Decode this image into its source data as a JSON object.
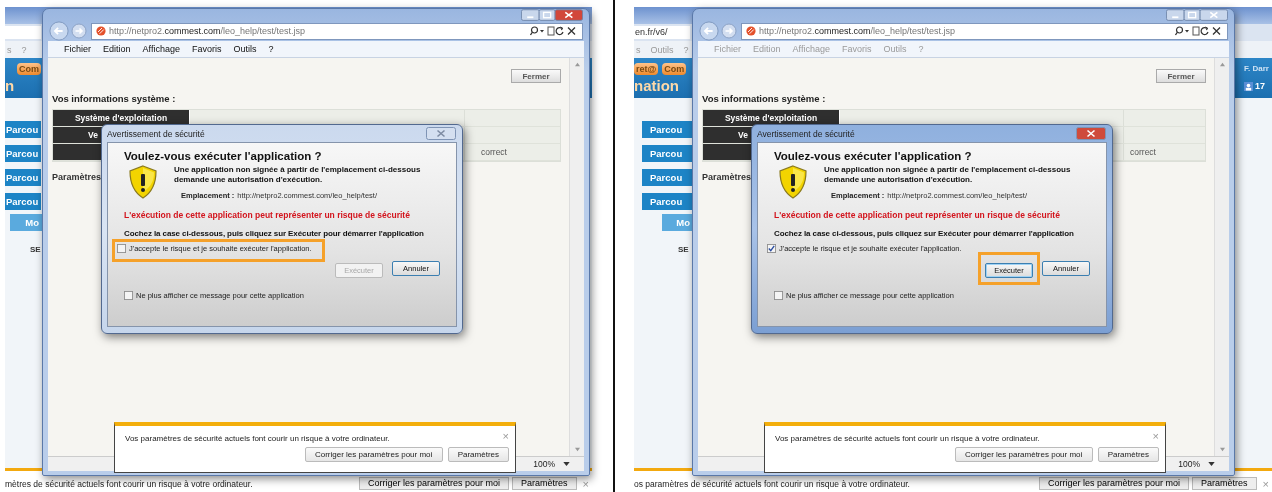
{
  "panels": [
    {
      "background": {
        "menu": [
          "s",
          "?"
        ],
        "tabs": [
          "Com"
        ],
        "title": "n",
        "nav_buttons": [
          "Parcou",
          "Parcou",
          "Parcou",
          "Parcou"
        ],
        "sub_button": "Mo",
        "section": "SE",
        "bottom_bar": {
          "text": "mètres de sécurité actuels font courir un risque à votre ordinateur.",
          "buttons": [
            "Corriger les paramètres pour moi",
            "Paramètres"
          ],
          "close": "×"
        }
      },
      "browser": {
        "active": true,
        "url": "http://netpro2.**commest.com**/leo_help/test/test.jsp",
        "menu": [
          "Fichier",
          "Edition",
          "Affichage",
          "Favoris",
          "Outils",
          "?"
        ],
        "close_button": "Fermer",
        "heading": "Vos informations système :",
        "rows": [
          {
            "column_1": "Système d'exploitation"
          },
          {
            "column_1": "Ve"
          },
          {
            "column_3": "correct"
          }
        ],
        "subheading": "Paramètres",
        "zoom": "100%"
      },
      "dialog": {
        "title": "Avertissement de sécurité",
        "active": false,
        "heading": "Voulez-vous exécuter l'application ?",
        "message": "Une application non signée à partir de l'emplacement ci-dessous demande une autorisation d'exécution.",
        "location_label": "Emplacement :",
        "location": "http://netpro2.commest.com/leo_help/test/",
        "warning": "L'exécution de cette application peut représenter un risque de sécurité",
        "instruction": "Cochez la case ci-dessous, puis cliquez sur Exécuter pour démarrer l'application",
        "accept": {
          "label": "J'accepte le risque et je souhaite exécuter l'application.",
          "checked": false,
          "highlighted": true
        },
        "run": {
          "label": "Exécuter",
          "disabled": true,
          "focused": false,
          "highlighted": false
        },
        "cancel": "Annuler",
        "dont_show": {
          "label": "Ne plus afficher ce message pour cette application",
          "checked": false
        }
      },
      "notification": {
        "text": "Vos paramètres de sécurité actuels font courir un risque à votre ordinateur.",
        "buttons": [
          "Corriger les paramètres pour moi",
          "Paramètres"
        ],
        "close": "×"
      }
    },
    {
      "background": {
        "address": "en.fr/v6/",
        "menu": [
          "s",
          "Outils",
          "?"
        ],
        "tabs": [
          "ret@",
          "Com"
        ],
        "title": "nation",
        "user": "F. Darr",
        "badge": "17",
        "nav_buttons": [
          "Parcou",
          "Parcou",
          "Parcou",
          "Parcou"
        ],
        "sub_button": "Mo",
        "section": "SE",
        "bottom_bar": {
          "text": "os paramètres de sécurité actuels font courir un risque à votre ordinateur.",
          "buttons": [
            "Corriger les paramètres pour moi",
            "Paramètres"
          ],
          "close": "×"
        }
      },
      "browser": {
        "active": false,
        "url": "http://netpro2.**commest.com**/leo_help/test/test.jsp",
        "menu": [
          "Fichier",
          "Edition",
          "Affichage",
          "Favoris",
          "Outils",
          "?"
        ],
        "close_button": "Fermer",
        "heading": "Vos informations système :",
        "rows": [
          {
            "column_1": "Système d'exploitation"
          },
          {
            "column_1": "Ve"
          },
          {
            "column_3": "correct"
          }
        ],
        "subheading": "Paramètres",
        "zoom": "100%"
      },
      "dialog": {
        "title": "Avertissement de sécurité",
        "active": true,
        "heading": "Voulez-vous exécuter l'application ?",
        "message": "Une application non signée à partir de l'emplacement ci-dessous demande une autorisation d'exécution.",
        "location_label": "Emplacement :",
        "location": "http://netpro2.commest.com/leo_help/test/",
        "warning": "L'exécution de cette application peut représenter un risque de sécurité",
        "instruction": "Cochez la case ci-dessous, puis cliquez sur Exécuter pour démarrer l'application",
        "accept": {
          "label": "J'accepte le risque et je souhaite exécuter l'application.",
          "checked": true,
          "highlighted": false
        },
        "run": {
          "label": "Exécuter",
          "disabled": false,
          "focused": true,
          "highlighted": true
        },
        "cancel": "Annuler",
        "dont_show": {
          "label": "Ne plus afficher ce message pour cette application",
          "checked": false
        }
      },
      "notification": {
        "text": "Vos paramètres de sécurité actuels font courir un risque à votre ordinateur.",
        "buttons": [
          "Corriger les paramètres pour moi",
          "Paramètres"
        ],
        "close": "×"
      }
    }
  ]
}
